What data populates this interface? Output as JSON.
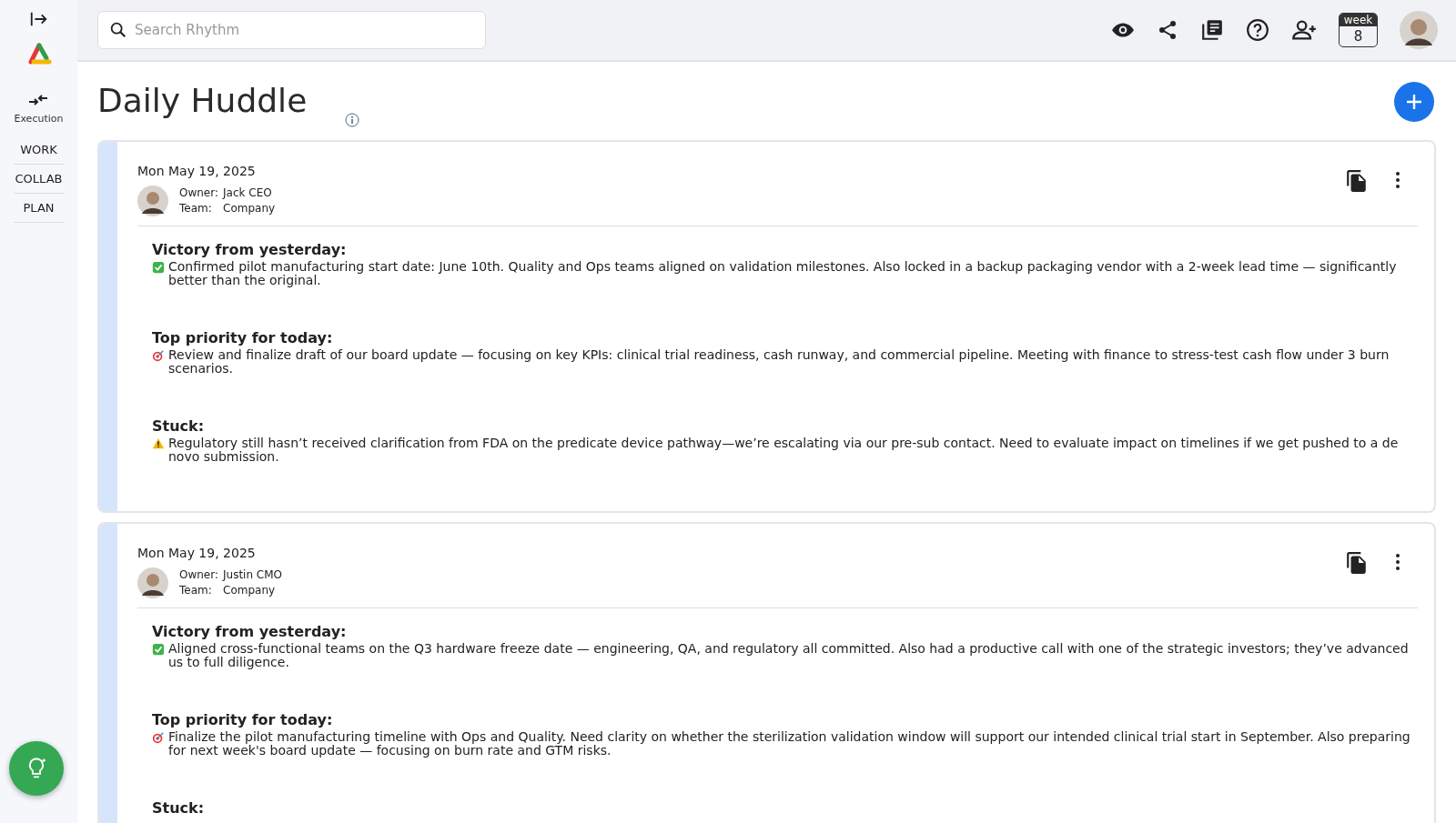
{
  "sidebar": {
    "section_label": "Execution",
    "nav_items": [
      {
        "label": "WORK"
      },
      {
        "label": "COLLAB"
      },
      {
        "label": "PLAN"
      }
    ]
  },
  "header": {
    "search": {
      "placeholder": "Search Rhythm"
    },
    "week_badge": {
      "label": "week",
      "number": "8"
    }
  },
  "page": {
    "title": "Daily Huddle"
  },
  "huddles": [
    {
      "date": "Mon May 19, 2025",
      "owner_label": "Owner:",
      "owner": "Jack CEO",
      "team_label": "Team:",
      "team": "Company",
      "sections": [
        {
          "kind": "victory",
          "heading": "Victory from yesterday:",
          "text": "Confirmed pilot manufacturing start date: June 10th. Quality and Ops teams aligned on validation milestones. Also locked in a backup packaging vendor with a 2-week lead time — significantly better than the original."
        },
        {
          "kind": "priority",
          "heading": "Top priority for today:",
          "text": "Review and finalize draft of our board update — focusing on key KPIs: clinical trial readiness, cash runway, and commercial pipeline. Meeting with finance to stress-test cash flow under 3 burn scenarios."
        },
        {
          "kind": "stuck",
          "heading": "Stuck:",
          "text": "Regulatory still hasn’t received clarification from FDA on the predicate device pathway—we’re escalating via our pre-sub contact. Need to evaluate impact on timelines if we get pushed to a de novo submission."
        }
      ]
    },
    {
      "date": "Mon May 19, 2025",
      "owner_label": "Owner:",
      "owner": "Justin CMO",
      "team_label": "Team:",
      "team": "Company",
      "sections": [
        {
          "kind": "victory",
          "heading": "Victory from yesterday:",
          "text": "Aligned cross-functional teams on the Q3 hardware freeze date — engineering, QA, and regulatory all committed. Also had a productive call with one of the strategic investors; they’ve advanced us to full diligence."
        },
        {
          "kind": "priority",
          "heading": "Top priority for today:",
          "text": "Finalize the pilot manufacturing timeline with Ops and Quality. Need clarity on whether the sterilization validation window will support our intended clinical trial start in September. Also preparing for next week's board update — focusing on burn rate and GTM risks."
        },
        {
          "heading": "Stuck:"
        }
      ]
    }
  ]
}
